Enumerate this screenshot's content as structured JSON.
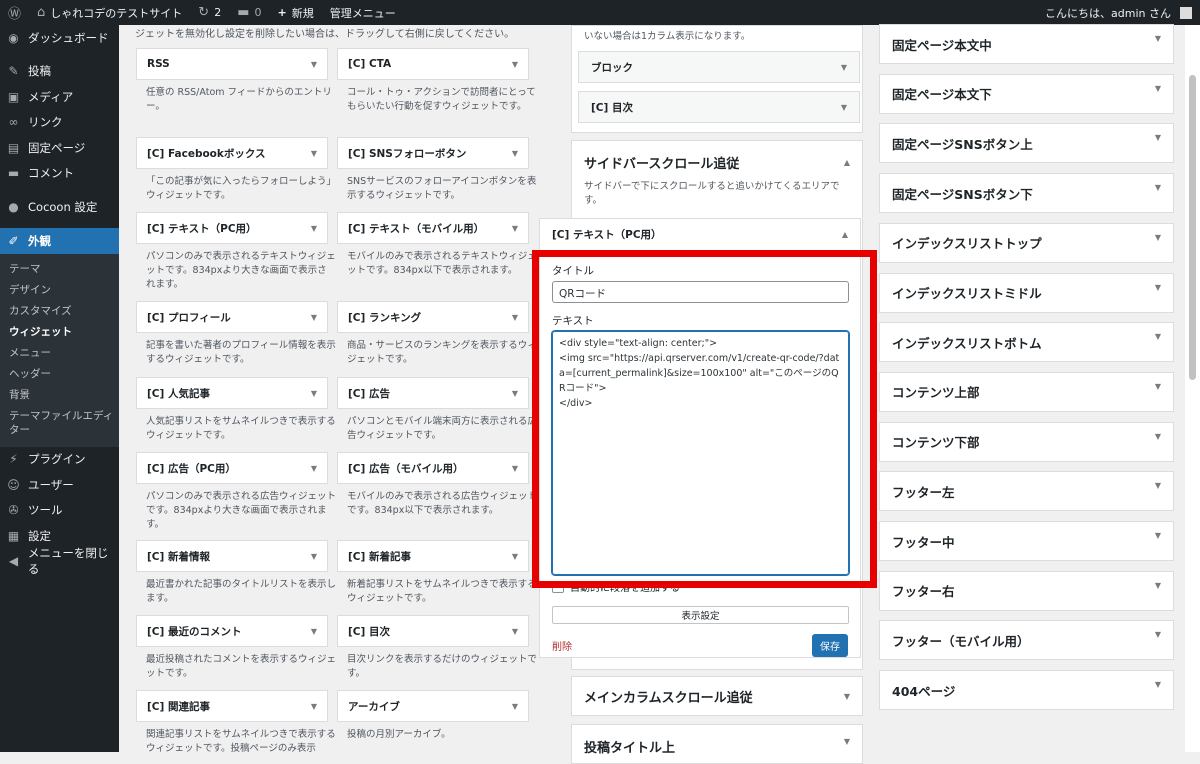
{
  "adminbar": {
    "site_name": "しゃれコデのテストサイト",
    "updates": "2",
    "comments": "0",
    "new_label": "新規",
    "admin_menu": "管理メニュー",
    "greeting": "こんにちは、admin さん"
  },
  "sidebar": {
    "items_top": [
      {
        "label": "ダッシュボード",
        "icon": "dashboard-icon",
        "glyph": "◉"
      },
      {
        "label": "投稿",
        "icon": "pin-icon",
        "glyph": "✎",
        "sep": true
      },
      {
        "label": "メディア",
        "icon": "media-icon",
        "glyph": "▣"
      },
      {
        "label": "リンク",
        "icon": "link-icon",
        "glyph": "∞"
      },
      {
        "label": "固定ページ",
        "icon": "page-icon",
        "glyph": "▤"
      },
      {
        "label": "コメント",
        "icon": "comment-icon",
        "glyph": "▬"
      },
      {
        "label": "Cocoon 設定",
        "icon": "cocoon-icon",
        "glyph": "●",
        "sep": true
      }
    ],
    "active": {
      "label": "外観",
      "icon": "appearance-icon",
      "glyph": "✐"
    },
    "submenu": [
      "テーマ",
      "デザイン",
      "カスタマイズ",
      "ウィジェット",
      "メニュー",
      "ヘッダー",
      "背景",
      "テーマファイルエディター"
    ],
    "submenu_current": "ウィジェット",
    "items_bottom": [
      {
        "label": "プラグイン",
        "icon": "plugin-icon",
        "glyph": "⚡"
      },
      {
        "label": "ユーザー",
        "icon": "user-icon",
        "glyph": "☺"
      },
      {
        "label": "ツール",
        "icon": "tool-icon",
        "glyph": "✇"
      },
      {
        "label": "設定",
        "icon": "settings-icon",
        "glyph": "▦"
      },
      {
        "label": "メニューを閉じる",
        "icon": "collapse-icon",
        "glyph": "◀"
      }
    ]
  },
  "available": {
    "description": "ジェットを無効化し設定を削除したい場合は、ドラッグして右側に戻してください。",
    "widgets": [
      {
        "title": "RSS",
        "desc": "任意の RSS/Atom フィードからのエントリー。"
      },
      {
        "title": "[C] CTA",
        "desc": "コール・トゥ・アクションで訪問者にとってもらいたい行動を促すウィジェットです。"
      },
      {
        "title": "[C] Facebookボックス",
        "desc": "「この記事が気に入ったらフォローしよう」ウィジェットです。"
      },
      {
        "title": "[C] SNSフォローボタン",
        "desc": "SNSサービスのフォローアイコンボタンを表示するウィジェットです。"
      },
      {
        "title": "[C] テキスト（PC用）",
        "desc": "パソコンのみで表示されるテキストウィジェットです。834pxより大きな画面で表示されます。"
      },
      {
        "title": "[C] テキスト（モバイル用）",
        "desc": "モバイルのみで表示されるテキストウィジェットです。834px以下で表示されます。"
      },
      {
        "title": "[C] プロフィール",
        "desc": "記事を書いた著者のプロフィール情報を表示するウィジェットです。"
      },
      {
        "title": "[C] ランキング",
        "desc": "商品・サービスのランキングを表示するウィジェットです。"
      },
      {
        "title": "[C] 人気記事",
        "desc": "人気記事リストをサムネイルつきで表示するウィジェットです。"
      },
      {
        "title": "[C] 広告",
        "desc": "パソコンとモバイル端末両方に表示される広告ウィジェットです。"
      },
      {
        "title": "[C] 広告（PC用）",
        "desc": "パソコンのみで表示される広告ウィジェットです。834pxより大きな画面で表示されます。"
      },
      {
        "title": "[C] 広告（モバイル用）",
        "desc": "モバイルのみで表示される広告ウィジェットです。834px以下で表示されます。"
      },
      {
        "title": "[C] 新着情報",
        "desc": "最近書かれた記事のタイトルリストを表示します。"
      },
      {
        "title": "[C] 新着記事",
        "desc": "新着記事リストをサムネイルつきで表示するウィジェットです。"
      },
      {
        "title": "[C] 最近のコメント",
        "desc": "最近投稿されたコメントを表示するウィジェットです。"
      },
      {
        "title": "[C] 目次",
        "desc": "目次リンクを表示するだけのウィジェットです。"
      },
      {
        "title": "[C] 関連記事",
        "desc": "関連記事リストをサムネイルつきで表示するウィジェットです。投稿ページのみ表示"
      },
      {
        "title": "アーカイブ",
        "desc": "投稿の月別アーカイブ。"
      }
    ]
  },
  "center": {
    "top_desc": "いない場合は1カラム表示になります。",
    "top_widgets": [
      "ブロック",
      "[C] 目次"
    ],
    "scroll_area": {
      "title": "サイドバースクロール追従",
      "desc": "サイドバーで下にスクロールすると追いかけてくるエリアです。"
    },
    "editor": {
      "header": "[C] テキスト（PC用）",
      "title_label": "タイトル",
      "title_value": "QRコード",
      "text_label": "テキスト",
      "text_value": "<div style=\"text-align: center;\">\n<img src=\"https://api.qrserver.com/v1/create-qr-code/?data=[current_permalink]&size=100x100\" alt=\"このページのQRコード\">\n</div>",
      "auto_paragraph": "自動的に段落を追加する",
      "display_settings": "表示設定",
      "delete": "削除",
      "save": "保存"
    },
    "bottom_areas": [
      "メインカラムスクロール追従",
      "投稿タイトル上"
    ]
  },
  "right_areas": [
    "固定ページ本文中",
    "固定ページ本文下",
    "固定ページSNSボタン上",
    "固定ページSNSボタン下",
    "インデックスリストトップ",
    "インデックスリストミドル",
    "インデックスリストボトム",
    "コンテンツ上部",
    "コンテンツ下部",
    "フッター左",
    "フッター中",
    "フッター右",
    "フッター（モバイル用）",
    "404ページ"
  ],
  "colors": {
    "highlight": "#e60000",
    "accent": "#2271b1",
    "admin_bar": "#1d2327"
  }
}
